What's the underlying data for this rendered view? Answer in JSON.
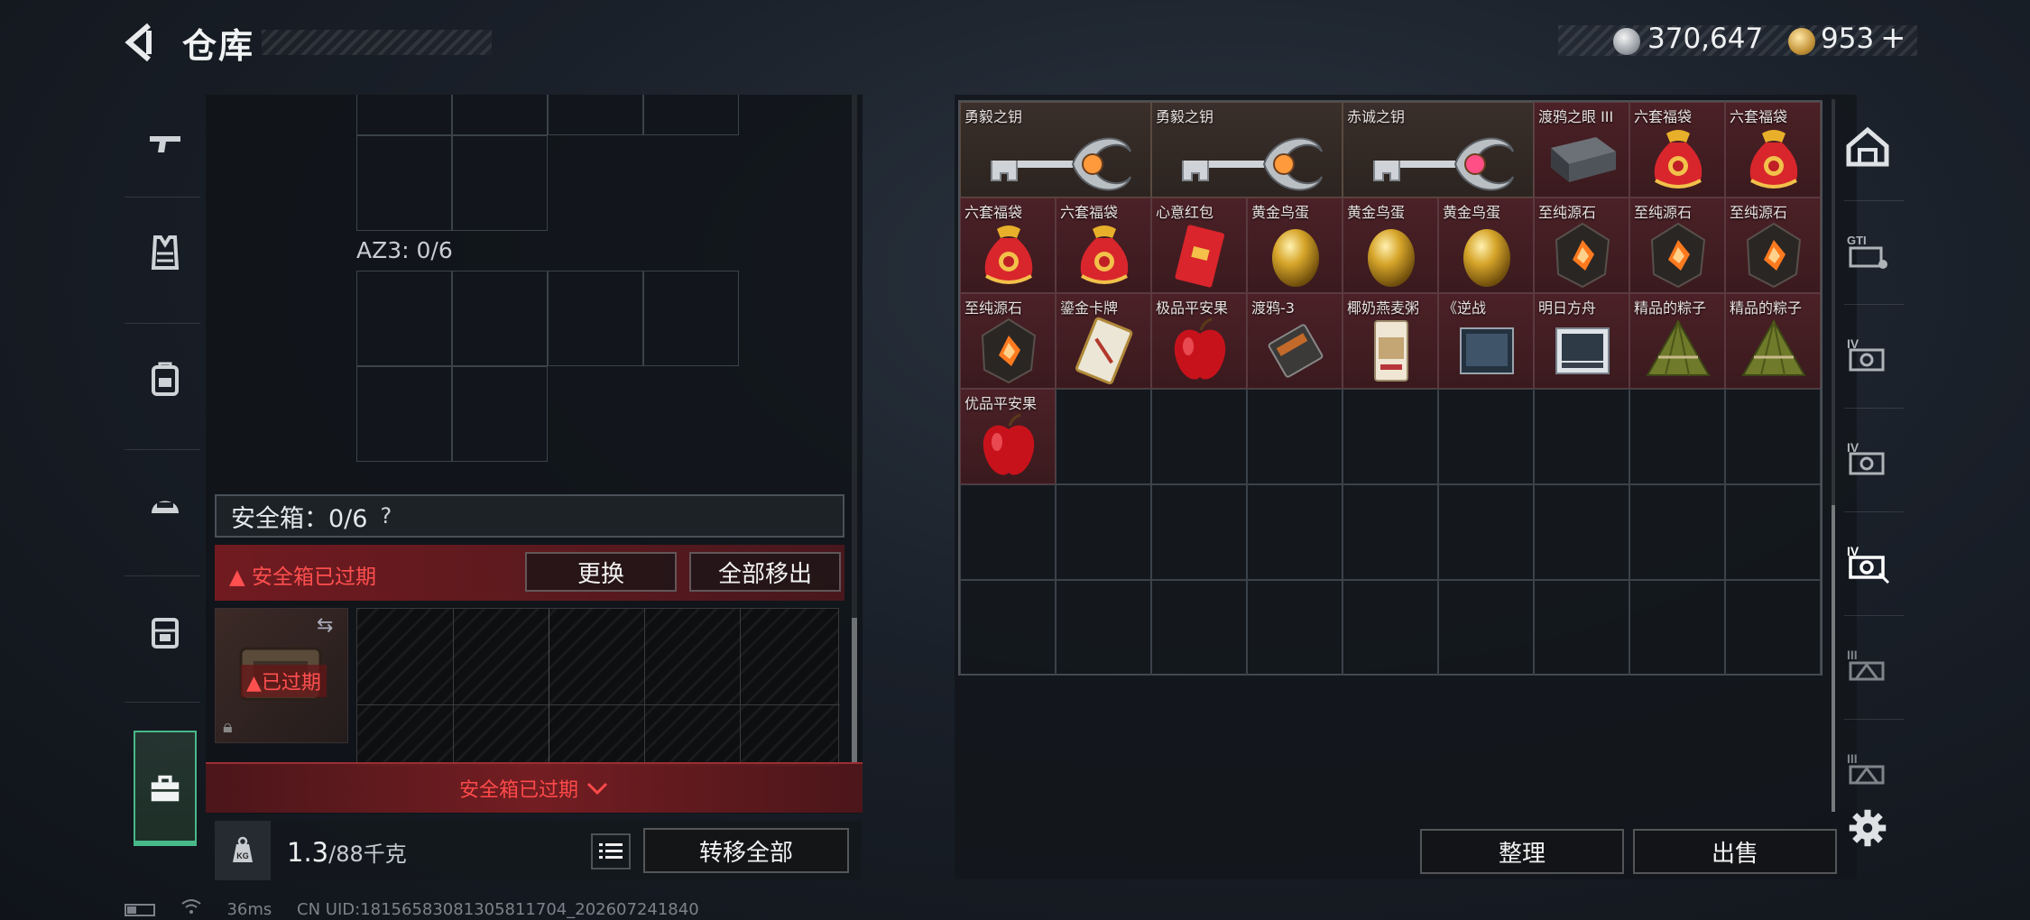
{
  "header": {
    "title": "仓库",
    "currency_silver": "370,647",
    "currency_gold": "953",
    "plus_label": "+"
  },
  "left_rail": {
    "items": [
      {
        "name": "guns",
        "icon": "pistol-icon"
      },
      {
        "name": "armor",
        "icon": "vest-icon"
      },
      {
        "name": "backpack",
        "icon": "backpack-icon"
      },
      {
        "name": "helmet",
        "icon": "helmet-icon"
      },
      {
        "name": "rig",
        "icon": "chest-rig-icon"
      },
      {
        "name": "safe-box",
        "icon": "toolbox-icon",
        "active": true
      }
    ]
  },
  "left_panel": {
    "az3_label": "AZ3: 0/6",
    "safe_box_label": "安全箱：0/6",
    "safe_help": "?",
    "expired_warning": "安全箱已过期",
    "replace_button": "更换",
    "move_all_button": "全部移出",
    "expired_tag": "已过期",
    "expired_footer": "安全箱已过期",
    "weight_value": "1.3",
    "weight_max": "/88千克",
    "weight_icon_text": "KG",
    "transfer_all_button": "转移全部"
  },
  "storage": {
    "items": [
      {
        "label": "勇毅之钥",
        "type": "key-silver-orange",
        "wide": true
      },
      {
        "label": "勇毅之钥",
        "type": "key-silver-orange",
        "wide": true
      },
      {
        "label": "赤诚之钥",
        "type": "key-silver-pink",
        "wide": true
      },
      {
        "label": "渡鸦之眼 III",
        "type": "device"
      },
      {
        "label": "六套福袋",
        "type": "lucky-bag"
      },
      {
        "label": "六套福袋",
        "type": "lucky-bag"
      },
      {
        "label": "六套福袋",
        "type": "lucky-bag"
      },
      {
        "label": "六套福袋",
        "type": "lucky-bag"
      },
      {
        "label": "心意红包",
        "type": "red-envelope"
      },
      {
        "label": "黄金鸟蛋",
        "type": "golden-egg"
      },
      {
        "label": "黄金鸟蛋",
        "type": "golden-egg"
      },
      {
        "label": "黄金鸟蛋",
        "type": "golden-egg"
      },
      {
        "label": "至纯源石",
        "type": "source-stone"
      },
      {
        "label": "至纯源石",
        "type": "source-stone"
      },
      {
        "label": "至纯源石",
        "type": "source-stone"
      },
      {
        "label": "至纯源石",
        "type": "source-stone"
      },
      {
        "label": "鎏金卡牌",
        "type": "gilded-card"
      },
      {
        "label": "极品平安果",
        "type": "apple"
      },
      {
        "label": "渡鸦-3",
        "type": "tape"
      },
      {
        "label": "椰奶燕麦粥",
        "type": "porridge"
      },
      {
        "label": "《逆战",
        "type": "book-dark"
      },
      {
        "label": "明日方舟",
        "type": "book-light"
      },
      {
        "label": "精品的粽子",
        "type": "zongzi"
      },
      {
        "label": "精品的粽子",
        "type": "zongzi"
      },
      {
        "label": "优品平安果",
        "type": "apple"
      }
    ],
    "sort_button": "整理",
    "sell_button": "出售"
  },
  "right_rail": {
    "tabs": [
      {
        "icon": "warehouse-icon"
      },
      {
        "icon": "gti-storage-icon"
      },
      {
        "icon": "iv-storage-icon"
      },
      {
        "icon": "iv-storage-icon"
      },
      {
        "icon": "iv-storage-active-icon",
        "active": true
      },
      {
        "icon": "iii-storage-icon"
      },
      {
        "icon": "iii-storage-icon"
      }
    ]
  },
  "status": {
    "ping": "36ms",
    "uid": "CN UID:1815658308130581170​4_202607241840"
  },
  "colors": {
    "accent_green": "#48b98a",
    "warning_red": "#ff4f4f",
    "item_bg_red": "#4b2126"
  }
}
